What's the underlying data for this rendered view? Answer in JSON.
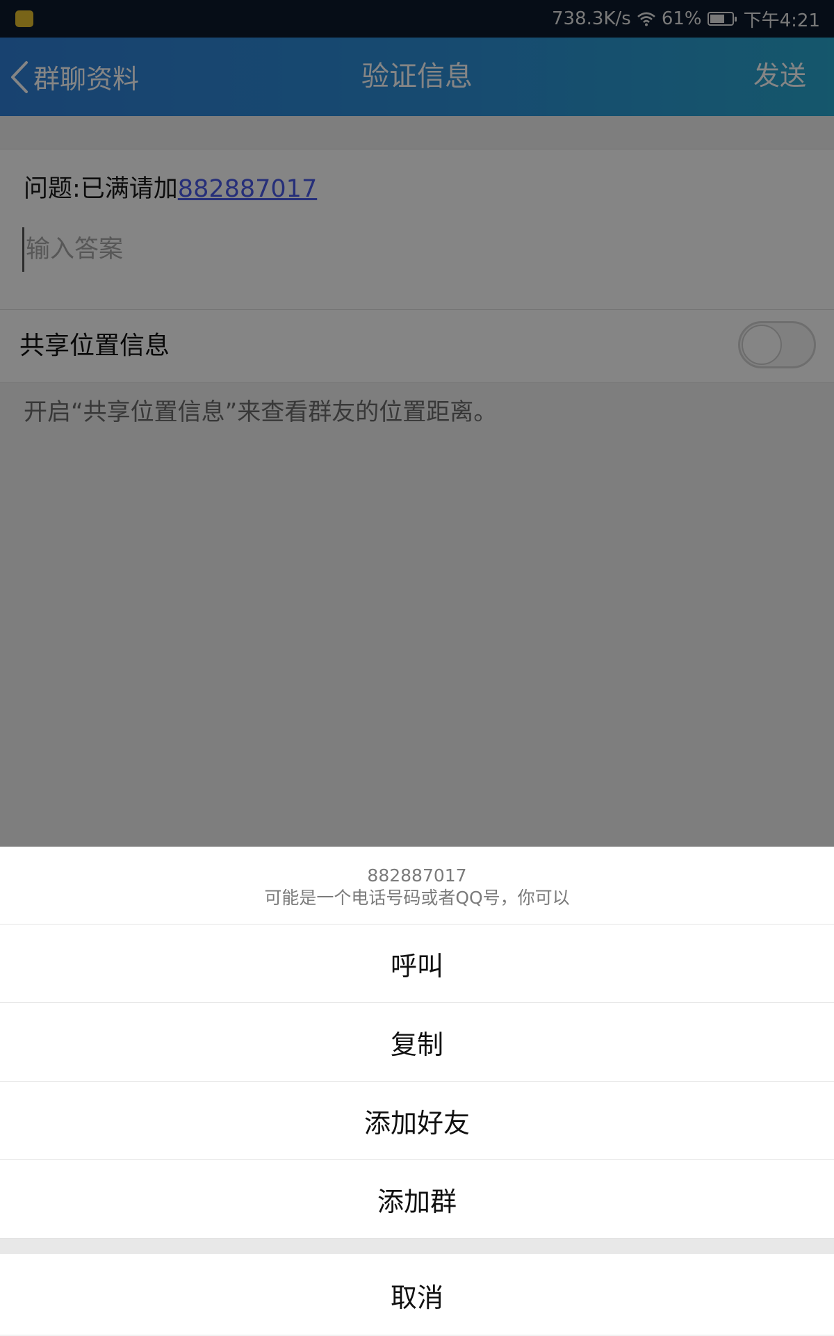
{
  "status_bar": {
    "net_speed": "738.3K/s",
    "battery": "61%",
    "time": "下午4:21",
    "app_icon": "notification-app-icon"
  },
  "title_bar": {
    "back_label": "群聊资料",
    "title": "验证信息",
    "send_label": "发送",
    "colors": {
      "gradient_start": "#2f7fd6",
      "gradient_end": "#2aa7cf"
    }
  },
  "question": {
    "prefix": "问题:已满请加",
    "link_number": "882887017"
  },
  "answer_input": {
    "value": "",
    "placeholder": "输入答案"
  },
  "share_location": {
    "label": "共享位置信息",
    "enabled": false,
    "hint": "开启“共享位置信息”来查看群友的位置距离。"
  },
  "action_sheet": {
    "title": "882887017",
    "subtitle": "可能是一个电话号码或者QQ号，你可以",
    "items": [
      {
        "label": "呼叫"
      },
      {
        "label": "复制"
      },
      {
        "label": "添加好友"
      },
      {
        "label": "添加群"
      }
    ],
    "cancel_label": "取消"
  }
}
